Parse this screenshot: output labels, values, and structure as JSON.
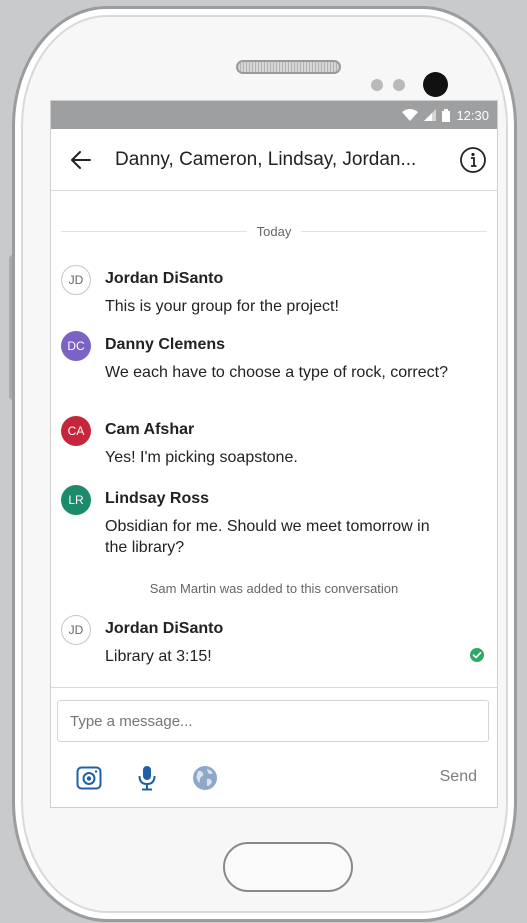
{
  "status_bar": {
    "time": "12:30"
  },
  "header": {
    "title": "Danny, Cameron, Lindsay, Jordan..."
  },
  "conversation": {
    "date_divider": "Today",
    "messages": [
      {
        "initials": "JD",
        "sender": "Jordan DiSanto",
        "text": "This is your group for the project!",
        "avatar_color": "#ffffff",
        "outline": true
      },
      {
        "initials": "DC",
        "sender": "Danny Clemens",
        "text": "We each have to choose a type of rock, correct?",
        "avatar_color": "#7b62c5",
        "outline": false
      },
      {
        "initials": "CA",
        "sender": "Cam Afshar",
        "text": "Yes! I'm picking soapstone.",
        "avatar_color": "#c4273b",
        "outline": false
      },
      {
        "initials": "LR",
        "sender": "Lindsay Ross",
        "text": "Obsidian for me. Should we meet tomorrow in the library?",
        "avatar_color": "#1d8a6b",
        "outline": false
      },
      {
        "initials": "JD",
        "sender": "Jordan DiSanto",
        "text": "Library at 3:15!",
        "avatar_color": "#ffffff",
        "outline": true
      }
    ],
    "system_message": "Sam Martin was added to this conversation"
  },
  "composer": {
    "placeholder": "Type a message...",
    "send_label": "Send",
    "tools": [
      "camera-icon",
      "microphone-icon",
      "globe-icon"
    ]
  },
  "colors": {
    "accent": "#1f5fa8",
    "sent_check": "#2eaa66"
  }
}
